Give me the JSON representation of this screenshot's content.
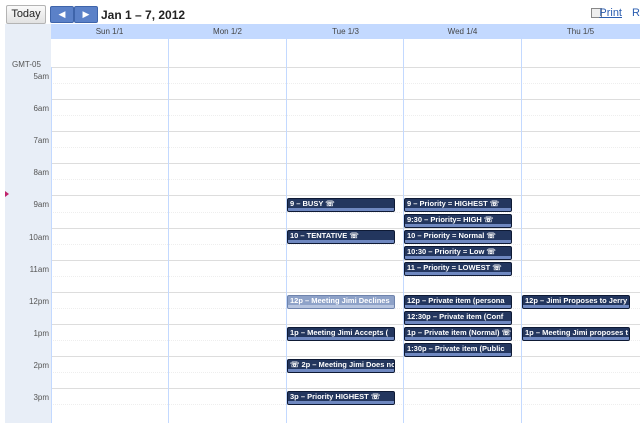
{
  "toolbar": {
    "today_label": "Today",
    "prev_label": "◀",
    "next_label": "▶",
    "date_range": "Jan 1 – 7, 2012",
    "print_label": "Print",
    "refresh_label": "R"
  },
  "timezone": "GMT-05",
  "days": [
    "Sun 1/1",
    "Mon 1/2",
    "Tue 1/3",
    "Wed 1/4",
    "Thu 1/5"
  ],
  "hours": [
    "5am",
    "6am",
    "7am",
    "8am",
    "9am",
    "10am",
    "11am",
    "12pm",
    "1pm",
    "2pm",
    "3pm"
  ],
  "events": {
    "tue_busy": "9 – BUSY ☏",
    "tue_tentative": "10 – TENTATIVE ☏",
    "tue_declines": "12p – Meeting Jimi Declines",
    "tue_accepts": "1p – Meeting Jimi Accepts (",
    "tue_doesnot": "☏ 2p – Meeting Jimi Does no",
    "tue_priority_highest": "3p – Priority HIGHEST ☏",
    "wed_highest": "9 – Priority = HIGHEST ☏",
    "wed_high": "9:30 – Priority= HIGH ☏",
    "wed_normal": "10 – Priority = Normal ☏",
    "wed_low": "10:30 – Priority = Low ☏",
    "wed_lowest": "11 – Priority = LOWEST ☏",
    "wed_private_personal": "12p – Private item (persona",
    "wed_private_conf": "12:30p – Private item (Conf",
    "wed_private_normal": "1p – Private item (Normal) ☏",
    "wed_private_public": "1:30p – Private item (Public",
    "thu_proposes_jerry": "12p – Jimi Proposes to Jerry",
    "thu_meeting_proposes": "1p – Meeting Jimi proposes t"
  }
}
